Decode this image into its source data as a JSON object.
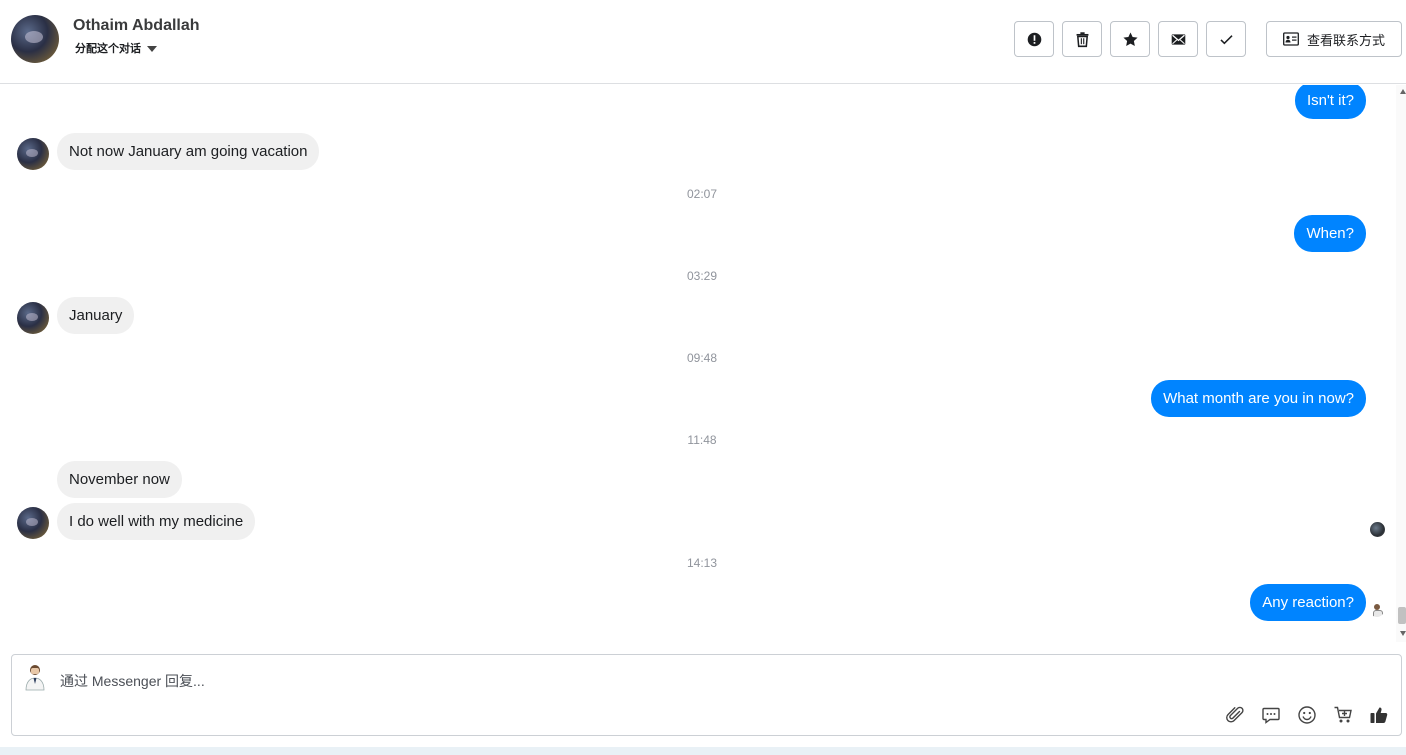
{
  "header": {
    "contact_name": "Othaim Abdallah",
    "assign_label": "分配这个对话",
    "toolbar": [
      {
        "name": "spam-button",
        "icon": "exclamation-circle-icon"
      },
      {
        "name": "delete-button",
        "icon": "trash-icon"
      },
      {
        "name": "star-button",
        "icon": "star-icon"
      },
      {
        "name": "mark-unread-button",
        "icon": "envelope-icon"
      },
      {
        "name": "mark-done-button",
        "icon": "check-icon"
      }
    ],
    "view_contact_label": "查看联系方式"
  },
  "messages": [
    {
      "type": "out",
      "text": "Isn't it?"
    },
    {
      "type": "in",
      "text": "Not now January am going vacation"
    },
    {
      "type": "time",
      "text": "02:07"
    },
    {
      "type": "out",
      "text": "When?"
    },
    {
      "type": "time",
      "text": "03:29"
    },
    {
      "type": "in",
      "text": "January"
    },
    {
      "type": "time",
      "text": "09:48"
    },
    {
      "type": "out",
      "text": "What month are you in now?"
    },
    {
      "type": "time",
      "text": "11:48"
    },
    {
      "type": "in",
      "text": "November now"
    },
    {
      "type": "in",
      "text": "I do well with my medicine"
    },
    {
      "type": "time",
      "text": "14:13"
    },
    {
      "type": "out",
      "text": "Any reaction?"
    }
  ],
  "composer": {
    "placeholder": "通过 Messenger 回复...",
    "tools": [
      "paperclip-icon",
      "chat-bubble-icon",
      "smiley-icon",
      "cart-icon",
      "thumbs-up-icon"
    ]
  },
  "colors": {
    "outgoing_bubble": "#0084ff",
    "incoming_bubble": "#f0f0f0",
    "timestamp": "#90949c"
  }
}
